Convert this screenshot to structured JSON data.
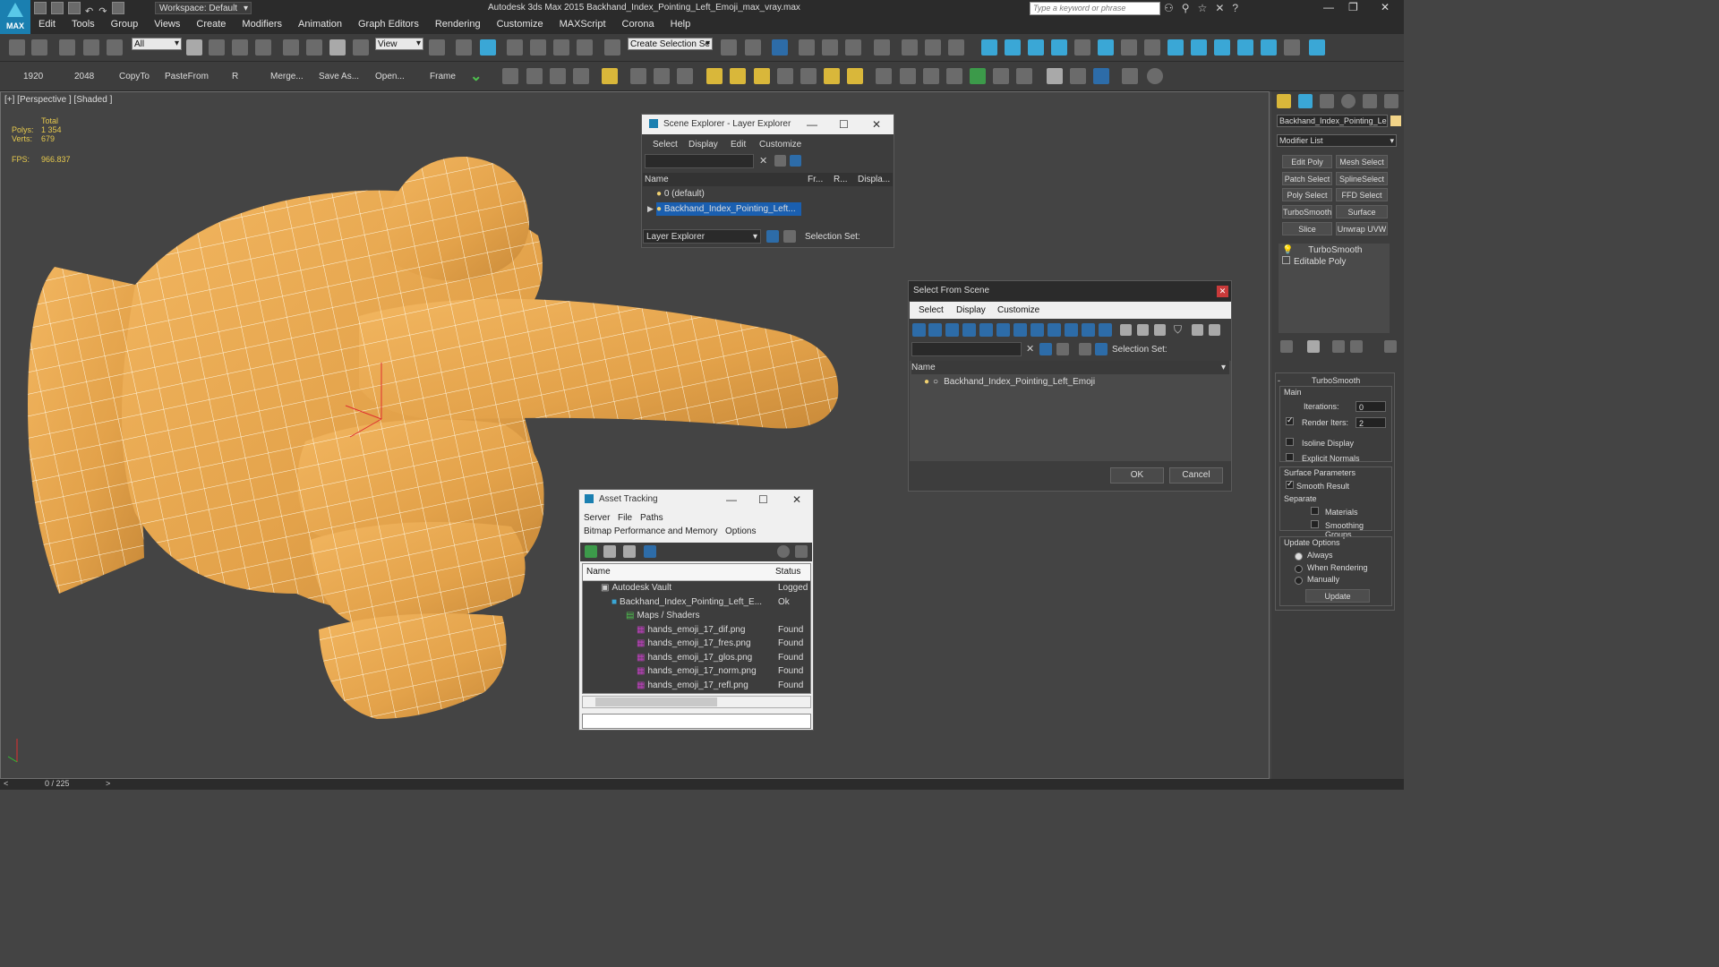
{
  "window": {
    "title": "Autodesk 3ds Max  2015     Backhand_Index_Pointing_Left_Emoji_max_vray.max",
    "workspace": "Workspace: Default",
    "search_placeholder": "Type a keyword or phrase",
    "logo": "MAX"
  },
  "menu": [
    "Edit",
    "Tools",
    "Group",
    "Views",
    "Create",
    "Modifiers",
    "Animation",
    "Graph Editors",
    "Rendering",
    "Customize",
    "MAXScript",
    "Corona",
    "Help"
  ],
  "toolbar": {
    "filter": "All",
    "ref_coord": "View",
    "selection_set_placeholder": "Create Selection Se"
  },
  "toolbar2": [
    "1920",
    "2048",
    "CopyTo",
    "PasteFrom",
    "R",
    "Merge...",
    "Save As...",
    "Open...",
    "Frame"
  ],
  "viewport": {
    "label": "[+] [Perspective ] [Shaded ]",
    "stats": {
      "total": "Total",
      "polys_label": "Polys:",
      "polys": "1 354",
      "verts_label": "Verts:",
      "verts": "679",
      "fps_label": "FPS:",
      "fps": "966.837"
    }
  },
  "scene_explorer": {
    "title": "Scene Explorer - Layer Explorer",
    "menu": [
      "Select",
      "Display",
      "Edit",
      "Customize"
    ],
    "columns": [
      "Name",
      "Fr...",
      "R...",
      "Displa..."
    ],
    "rows": [
      "0 (default)",
      "Backhand_Index_Pointing_Left..."
    ],
    "footer_combo": "Layer Explorer",
    "selection_set": "Selection Set:"
  },
  "select_from_scene": {
    "title": "Select From Scene",
    "menu": [
      "Select",
      "Display",
      "Customize"
    ],
    "selection_set": "Selection Set:",
    "column": "Name",
    "rows": [
      "Backhand_Index_Pointing_Left_Emoji"
    ],
    "ok": "OK",
    "cancel": "Cancel"
  },
  "asset_tracking": {
    "title": "Asset Tracking",
    "menu1": [
      "Server",
      "File",
      "Paths"
    ],
    "menu2": [
      "Bitmap Performance and Memory",
      "Options"
    ],
    "columns": [
      "Name",
      "Status"
    ],
    "rows": [
      {
        "name": "Autodesk Vault",
        "status": "Logged"
      },
      {
        "name": "Backhand_Index_Pointing_Left_E...",
        "status": "Ok"
      },
      {
        "name": "Maps / Shaders",
        "status": ""
      },
      {
        "name": "hands_emoji_17_dif.png",
        "status": "Found"
      },
      {
        "name": "hands_emoji_17_fres.png",
        "status": "Found"
      },
      {
        "name": "hands_emoji_17_glos.png",
        "status": "Found"
      },
      {
        "name": "hands_emoji_17_norm.png",
        "status": "Found"
      },
      {
        "name": "hands_emoji_17_refl.png",
        "status": "Found"
      }
    ]
  },
  "command_panel": {
    "object_name": "Backhand_Index_Pointing_Le",
    "modifier_list": "Modifier List",
    "buttons": [
      "Edit Poly",
      "Mesh Select",
      "Patch Select",
      "SplineSelect",
      "Poly Select",
      "FFD Select",
      "TurboSmooth",
      "Surface Select",
      "Slice",
      "Unwrap UVW"
    ],
    "stack": [
      "TurboSmooth",
      "Editable Poly"
    ],
    "rollout_title": "TurboSmooth",
    "main": "Main",
    "iterations_label": "Iterations:",
    "iterations": "0",
    "render_iters_label": "Render Iters:",
    "render_iters": "2",
    "isoline": "Isoline Display",
    "explicit": "Explicit Normals",
    "surface_params": "Surface Parameters",
    "smooth_result": "Smooth Result",
    "separate": "Separate",
    "materials": "Materials",
    "smoothing_groups": "Smoothing Groups",
    "update_options": "Update Options",
    "always": "Always",
    "when_rendering": "When Rendering",
    "manually": "Manually",
    "update": "Update"
  },
  "timeline": {
    "frame": "0 / 225"
  },
  "colors": {
    "accent": "#1a7fb0",
    "mesh": "#e8a84a",
    "selection": "#1a5fb0"
  }
}
